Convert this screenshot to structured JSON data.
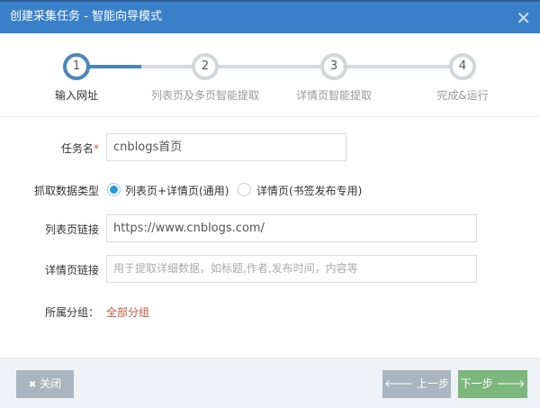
{
  "dialog": {
    "title": "创建采集任务 - 智能向导模式",
    "close_icon": "✕"
  },
  "steps": [
    {
      "number": "1",
      "label": "输入网址",
      "active": true
    },
    {
      "number": "2",
      "label": "列表页及多页智能提取",
      "active": false
    },
    {
      "number": "3",
      "label": "详情页智能提取",
      "active": false
    },
    {
      "number": "4",
      "label": "完成&运行",
      "active": false
    }
  ],
  "form": {
    "task_name_label": "任务名",
    "required_mark": "*",
    "task_name_value": "cnblogs首页",
    "data_type_label": "抓取数据类型",
    "data_type_options": [
      {
        "label": "列表页+详情页(通用)",
        "selected": true
      },
      {
        "label": "详情页(书签发布专用)",
        "selected": false
      }
    ],
    "list_url_label": "列表页链接",
    "list_url_value": "https://www.cnblogs.com/",
    "detail_url_label": "详情页链接",
    "detail_url_placeholder": "用于提取详细数据，如标题,作者,发布时间，内容等",
    "group_label": "所属分组：",
    "group_value": "全部分组"
  },
  "footer": {
    "close_label": "关闭",
    "close_icon": "✖",
    "prev_label": "上一步",
    "prev_icon": "🡐",
    "next_label": "下一步",
    "next_icon": "🡒"
  }
}
